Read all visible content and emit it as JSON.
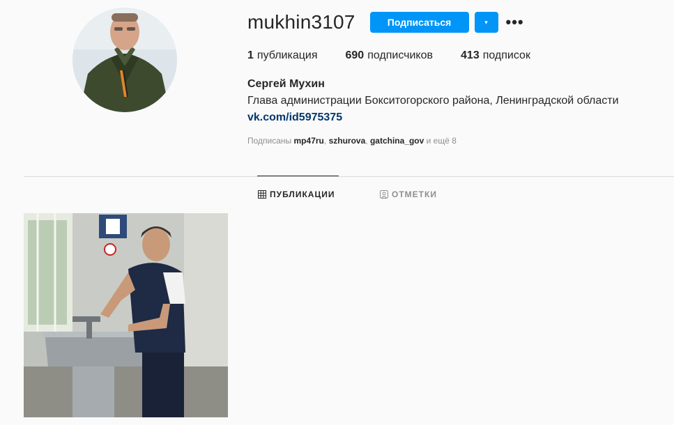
{
  "profile": {
    "username": "mukhin3107",
    "follow_label": "Подписаться",
    "dropdown_icon": "▾",
    "more_icon": "•••",
    "stats": {
      "posts_count": "1",
      "posts_label": "публикация",
      "followers_count": "690",
      "followers_label": "подписчиков",
      "following_count": "413",
      "following_label": "подписок"
    },
    "full_name": "Сергей Мухин",
    "bio": "Глава администрации Бокситогорского района, Ленинградской области",
    "link": "vk.com/id5975375",
    "followed_by": {
      "prefix": "Подписаны",
      "accounts": [
        "mp47ru",
        "szhurova",
        "gatchina_gov"
      ],
      "suffix": "и ещё 8"
    }
  },
  "tabs": [
    {
      "label": "ПУБЛИКАЦИИ",
      "icon": "grid-icon",
      "active": true
    },
    {
      "label": "ОТМЕТКИ",
      "icon": "tagged-icon",
      "active": false
    }
  ],
  "colors": {
    "accent": "#0095f6",
    "link": "#00376b",
    "muted": "#8e8e8e",
    "background": "#fafafa"
  }
}
